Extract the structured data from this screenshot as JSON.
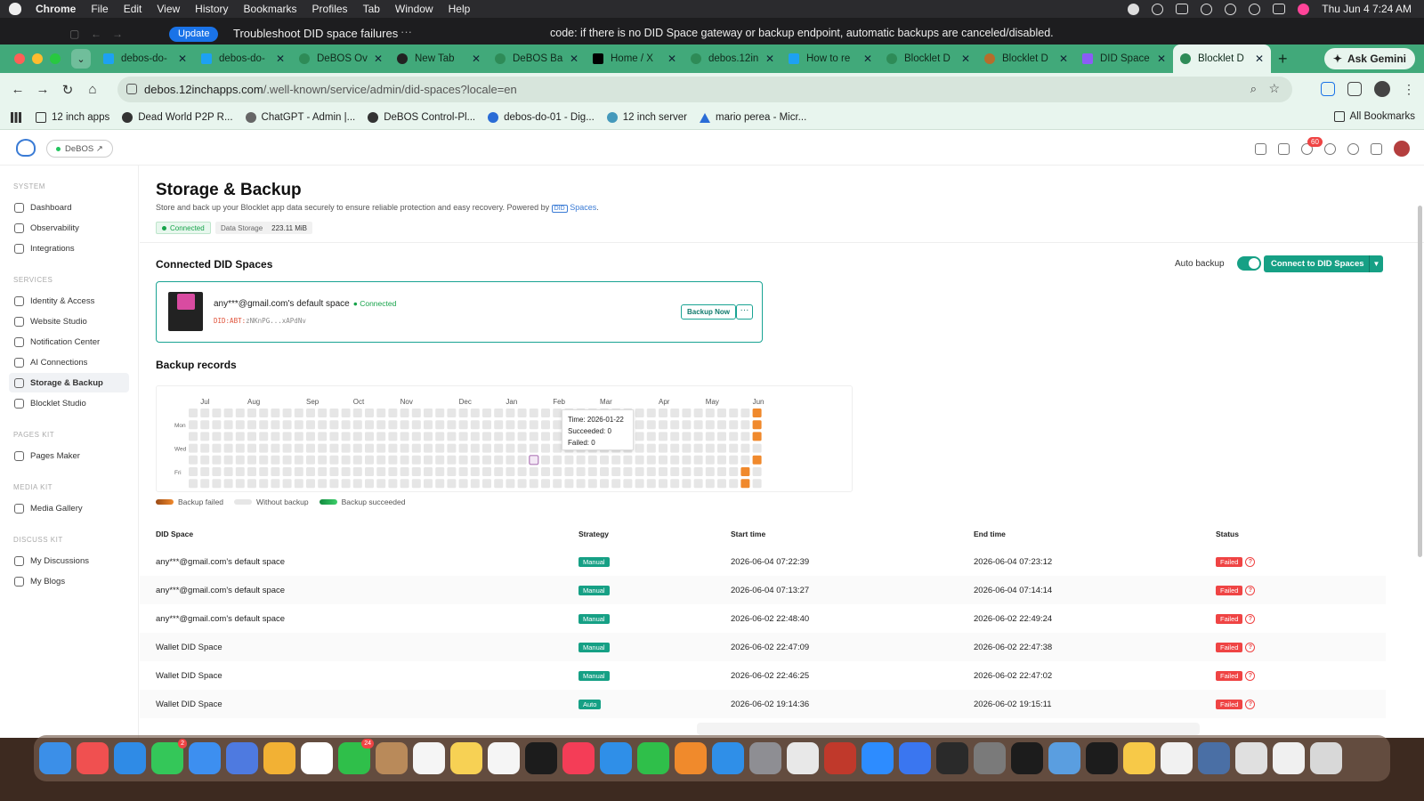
{
  "menubar": {
    "app": "Chrome",
    "items": [
      "File",
      "Edit",
      "View",
      "History",
      "Bookmarks",
      "Profiles",
      "Tab",
      "Window",
      "Help"
    ],
    "clock": "Thu Jun 4  7:24 AM"
  },
  "chrome_top": {
    "update_label": "Update",
    "window_title": "Troubleshoot DID space failures",
    "more": "···",
    "notice": "code: if there is no DID Space gateway or backup endpoint, automatic backups are canceled/disabled."
  },
  "tabs": [
    {
      "label": "debos-do-",
      "icon": "blue"
    },
    {
      "label": "debos-do-",
      "icon": "blue"
    },
    {
      "label": "DeBOS Ov",
      "icon": "green"
    },
    {
      "label": "New Tab",
      "icon": "dark"
    },
    {
      "label": "DeBOS Ba",
      "icon": "green"
    },
    {
      "label": "Home / X",
      "icon": "x-logo"
    },
    {
      "label": "debos.12in",
      "icon": "green"
    },
    {
      "label": "How to re",
      "icon": "blue"
    },
    {
      "label": "Blocklet D",
      "icon": "green"
    },
    {
      "label": "Blocklet D",
      "icon": "orange"
    },
    {
      "label": "DID Space",
      "icon": "purple"
    },
    {
      "label": "Blocklet D",
      "icon": "green",
      "active": true
    }
  ],
  "ask_gemini": "Ask Gemini",
  "omnibox": {
    "url_host": "debos.12inchapps.com",
    "url_path": "/.well-known/service/admin/did-spaces?locale=en"
  },
  "bookmarks": [
    "12 inch apps",
    "Dead World P2P R...",
    "ChatGPT - Admin |...",
    "DeBOS Control-Pl...",
    "debos-do-01 - Dig...",
    "12 inch server",
    "mario perea - Micr..."
  ],
  "all_bookmarks": "All Bookmarks",
  "app_header": {
    "chip": "DeBOS ↗",
    "notif_count": "60"
  },
  "sidebar": {
    "sections": [
      {
        "title": "SYSTEM",
        "items": [
          "Dashboard",
          "Observability",
          "Integrations"
        ]
      },
      {
        "title": "SERVICES",
        "items": [
          "Identity & Access",
          "Website Studio",
          "Notification Center",
          "AI Connections",
          "Storage & Backup",
          "Blocklet Studio"
        ]
      },
      {
        "title": "PAGES KIT",
        "items": [
          "Pages Maker"
        ]
      },
      {
        "title": "MEDIA KIT",
        "items": [
          "Media Gallery"
        ]
      },
      {
        "title": "DISCUSS KIT",
        "items": [
          "My Discussions",
          "My Blogs"
        ]
      }
    ],
    "active": "Storage & Backup"
  },
  "page": {
    "title": "Storage & Backup",
    "subtitle": "Store and back up your Blocklet app data securely to ensure reliable protection and easy recovery. Powered by",
    "did_tag": "DID",
    "spaces_link": "Spaces",
    "subtitle_end": ".",
    "status_connected": "Connected",
    "data_storage_label": "Data Storage",
    "data_storage_value": "223.11 MiB",
    "connected_heading": "Connected DID Spaces",
    "auto_backup_label": "Auto backup",
    "connect_button": "Connect to DID Spaces",
    "space_card": {
      "name": "any***@gmail.com's default space",
      "status": "Connected",
      "did_prefix": "DID:ABT:",
      "did_value": "zNKnPG...xAPdNv",
      "backup_now": "Backup Now",
      "more": "···"
    },
    "records_heading": "Backup records"
  },
  "heatmap": {
    "months": [
      {
        "label": "Jul",
        "col": 1
      },
      {
        "label": "Aug",
        "col": 5
      },
      {
        "label": "Sep",
        "col": 10
      },
      {
        "label": "Oct",
        "col": 14
      },
      {
        "label": "Nov",
        "col": 18
      },
      {
        "label": "Dec",
        "col": 23
      },
      {
        "label": "Jan",
        "col": 27
      },
      {
        "label": "Feb",
        "col": 31
      },
      {
        "label": "Mar",
        "col": 35
      },
      {
        "label": "Apr",
        "col": 40
      },
      {
        "label": "May",
        "col": 44
      },
      {
        "label": "Jun",
        "col": 48
      }
    ],
    "days": [
      {
        "label": "Mon",
        "row": 1
      },
      {
        "label": "Wed",
        "row": 3
      },
      {
        "label": "Fri",
        "row": 5
      }
    ],
    "weeks": 49,
    "failed_cells": [
      [
        48,
        0
      ],
      [
        48,
        1
      ],
      [
        48,
        2
      ],
      [
        48,
        4
      ],
      [
        47,
        5
      ],
      [
        47,
        6
      ]
    ],
    "hover_cell": [
      29,
      4
    ],
    "tooltip": {
      "time": "Time: 2026-01-22",
      "succeeded": "Succeeded: 0",
      "failed": "Failed: 0"
    },
    "colors": {
      "empty": "#e6e6e6",
      "failed": "#f0892c",
      "hover": "#b07ab8"
    },
    "legend": {
      "failed": "Backup failed",
      "without": "Without backup",
      "succeeded": "Backup succeeded"
    }
  },
  "table": {
    "headers": {
      "space": "DID Space",
      "strategy": "Strategy",
      "start": "Start time",
      "end": "End time",
      "status": "Status"
    },
    "rows": [
      {
        "space": "any***@gmail.com's default space",
        "strategy": "Manual",
        "start": "2026-06-04 07:22:39",
        "end": "2026-06-04 07:23:12",
        "status": "Failed"
      },
      {
        "space": "any***@gmail.com's default space",
        "strategy": "Manual",
        "start": "2026-06-04 07:13:27",
        "end": "2026-06-04 07:14:14",
        "status": "Failed"
      },
      {
        "space": "any***@gmail.com's default space",
        "strategy": "Manual",
        "start": "2026-06-02 22:48:40",
        "end": "2026-06-02 22:49:24",
        "status": "Failed"
      },
      {
        "space": "Wallet DID Space",
        "strategy": "Manual",
        "start": "2026-06-02 22:47:09",
        "end": "2026-06-02 22:47:38",
        "status": "Failed"
      },
      {
        "space": "Wallet DID Space",
        "strategy": "Manual",
        "start": "2026-06-02 22:46:25",
        "end": "2026-06-02 22:47:02",
        "status": "Failed"
      },
      {
        "space": "Wallet DID Space",
        "strategy": "Auto",
        "start": "2026-06-02 19:14:36",
        "end": "2026-06-02 19:15:11",
        "status": "Failed"
      }
    ]
  },
  "dock": {
    "apps": [
      {
        "name": "finder",
        "color": "#3b8fe8"
      },
      {
        "name": "news",
        "color": "#f05050"
      },
      {
        "name": "safari",
        "color": "#2f8be6"
      },
      {
        "name": "messages",
        "color": "#34c759",
        "badge": "2"
      },
      {
        "name": "mail",
        "color": "#3d8ff0"
      },
      {
        "name": "app-store-alt",
        "color": "#4e7ae0"
      },
      {
        "name": "photos",
        "color": "#f2b134"
      },
      {
        "name": "calendar",
        "color": "#ffffff"
      },
      {
        "name": "facetime",
        "color": "#2fbf4a",
        "badge": "24"
      },
      {
        "name": "contacts",
        "color": "#b98a5a"
      },
      {
        "name": "reminders",
        "color": "#f5f5f5"
      },
      {
        "name": "notes",
        "color": "#f7d154"
      },
      {
        "name": "freeform",
        "color": "#f5f5f5"
      },
      {
        "name": "tv",
        "color": "#1c1c1c"
      },
      {
        "name": "music",
        "color": "#f43d57"
      },
      {
        "name": "keynote",
        "color": "#2f8fe8"
      },
      {
        "name": "numbers",
        "color": "#2fbf4a"
      },
      {
        "name": "pages",
        "color": "#f08a2c"
      },
      {
        "name": "app-store",
        "color": "#2f8fe8"
      },
      {
        "name": "settings",
        "color": "#8e8e93"
      },
      {
        "name": "chrome",
        "color": "#e8e8e8"
      },
      {
        "name": "remote",
        "color": "#c0392b"
      },
      {
        "name": "zoom",
        "color": "#2d8cff"
      },
      {
        "name": "signal",
        "color": "#3a76f0"
      },
      {
        "name": "calculator",
        "color": "#2a2a2a"
      },
      {
        "name": "launchpad",
        "color": "#7a7a7a"
      },
      {
        "name": "cursor",
        "color": "#1c1c1c"
      },
      {
        "name": "preview",
        "color": "#5a9ee0"
      },
      {
        "name": "cursor-2",
        "color": "#1c1c1c"
      },
      {
        "name": "tips",
        "color": "#f7c948"
      },
      {
        "name": "document",
        "color": "#f1f1f1"
      },
      {
        "name": "screenshot",
        "color": "#4a6fa5"
      },
      {
        "name": "folder-stack",
        "color": "#e0e0e0"
      },
      {
        "name": "downloads",
        "color": "#f0f0f0"
      },
      {
        "name": "trash",
        "color": "#d8d8d8"
      }
    ]
  }
}
